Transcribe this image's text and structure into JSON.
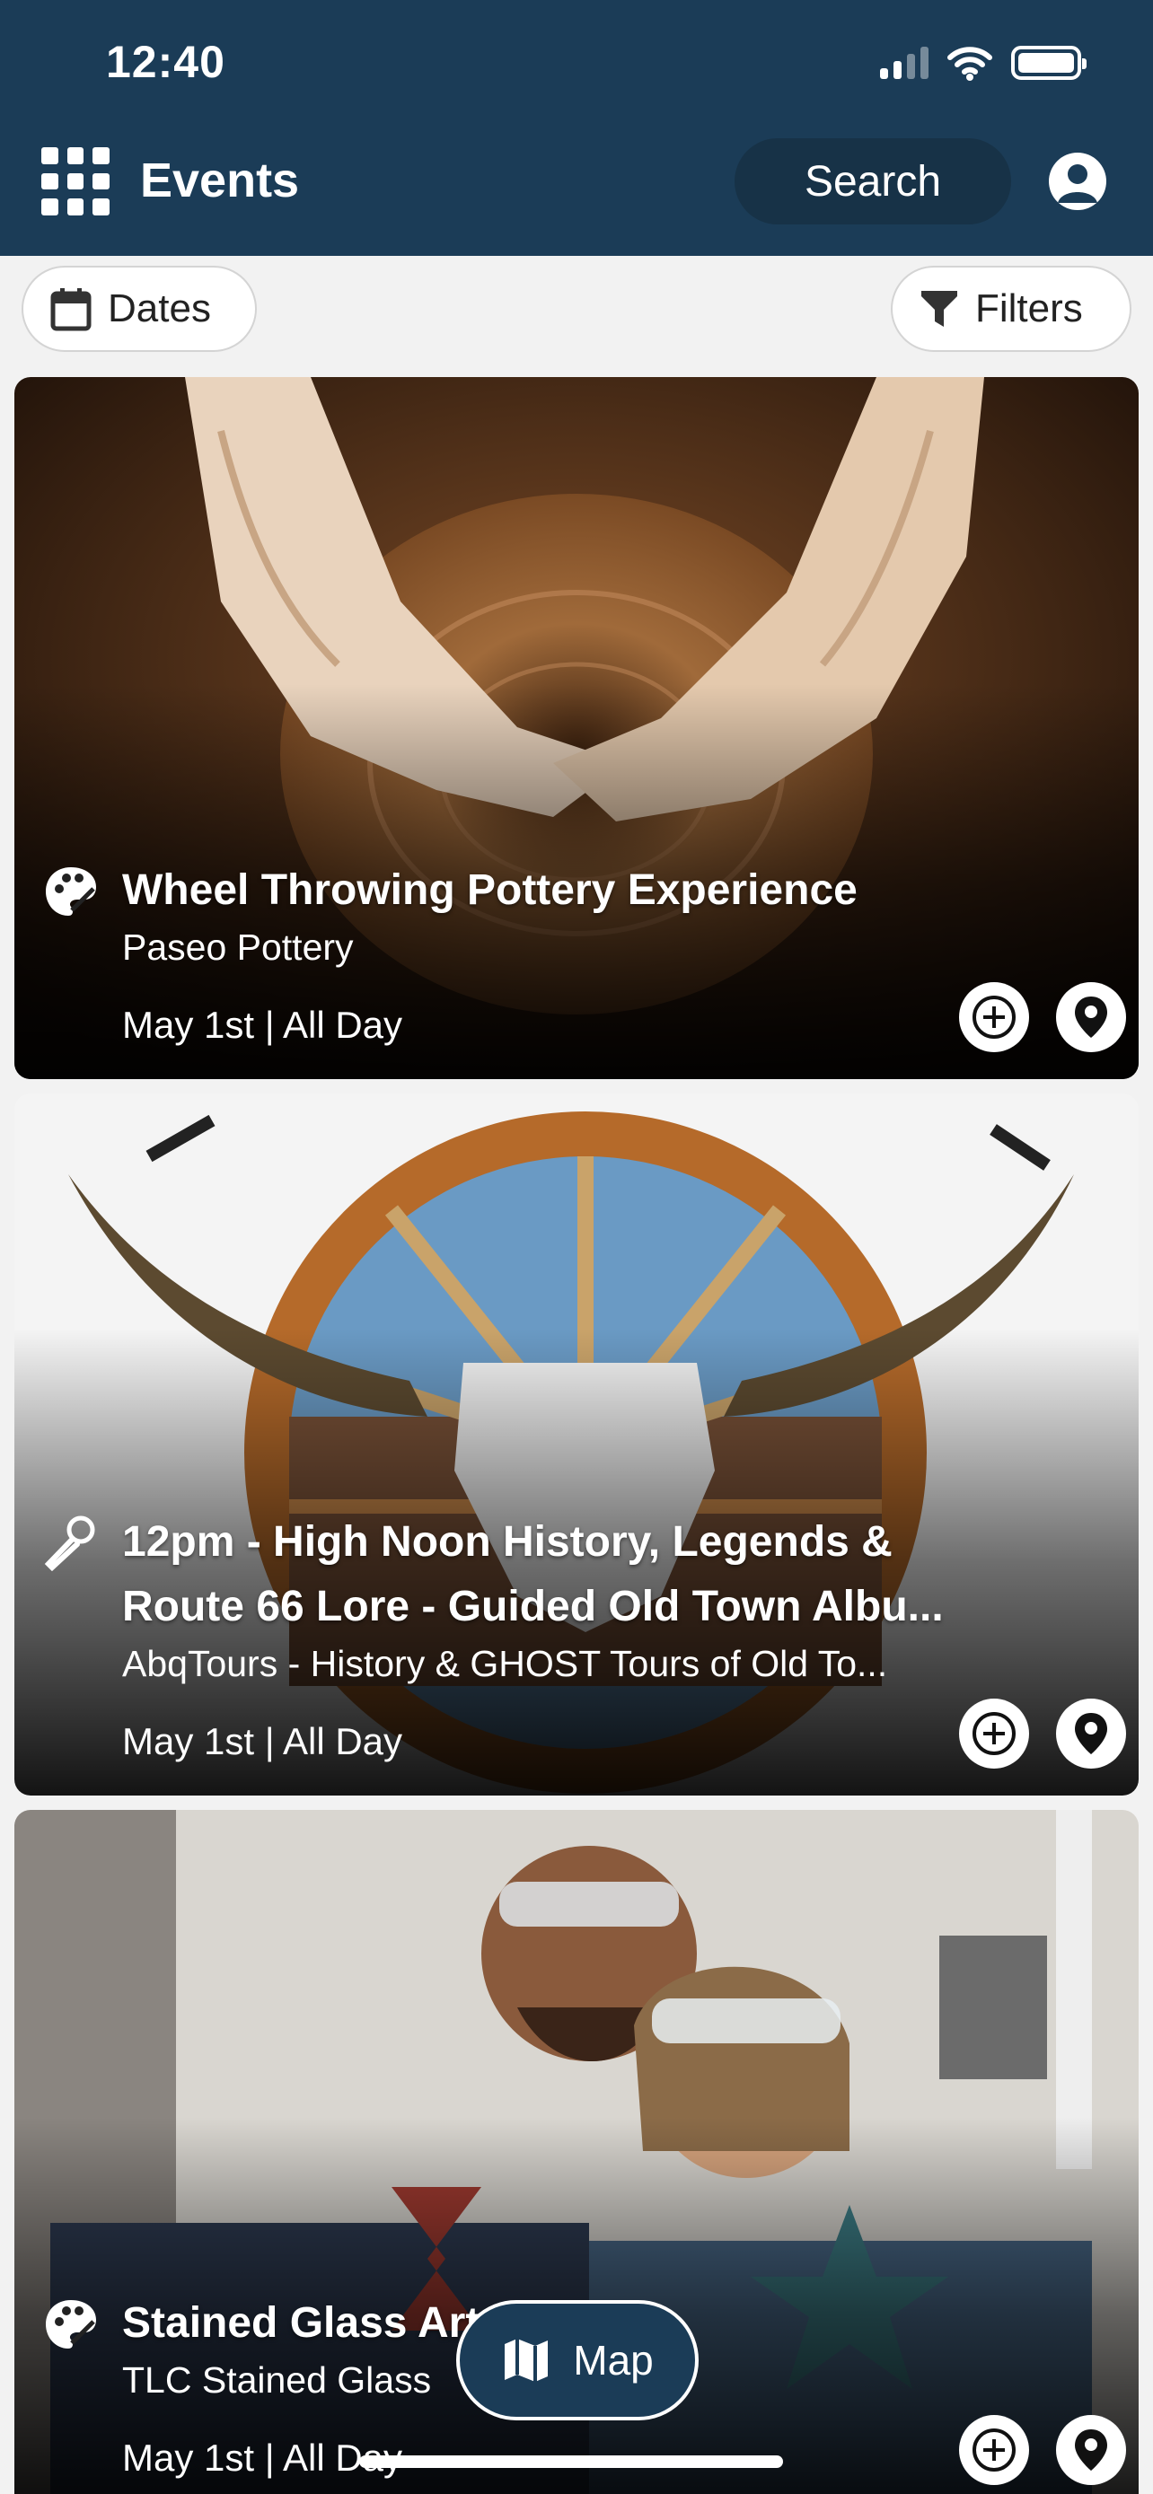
{
  "status_bar": {
    "time": "12:40"
  },
  "header": {
    "title": "Events",
    "search_label": "Search"
  },
  "filter_bar": {
    "dates_label": "Dates",
    "filters_label": "Filters"
  },
  "events": [
    {
      "title": "Wheel Throwing Pottery Experience",
      "venue": "Paseo Pottery",
      "date": "May 1st | All Day",
      "category_icon": "palette-icon"
    },
    {
      "title": "12pm - High Noon History, Legends & Route 66 Lore - Guided Old Town Albu...",
      "venue": "AbqTours - History & GHOST Tours of Old To...",
      "date": "May 1st | All Day",
      "category_icon": "microphone-icon"
    },
    {
      "title": "Stained Glass Art ... e",
      "venue": "TLC Stained Glass",
      "date": "May 1st | All Day",
      "category_icon": "palette-icon"
    }
  ],
  "map_button": {
    "label": "Map"
  },
  "colors": {
    "header_bg": "#1b3c57",
    "page_bg": "#f2f2f2"
  }
}
